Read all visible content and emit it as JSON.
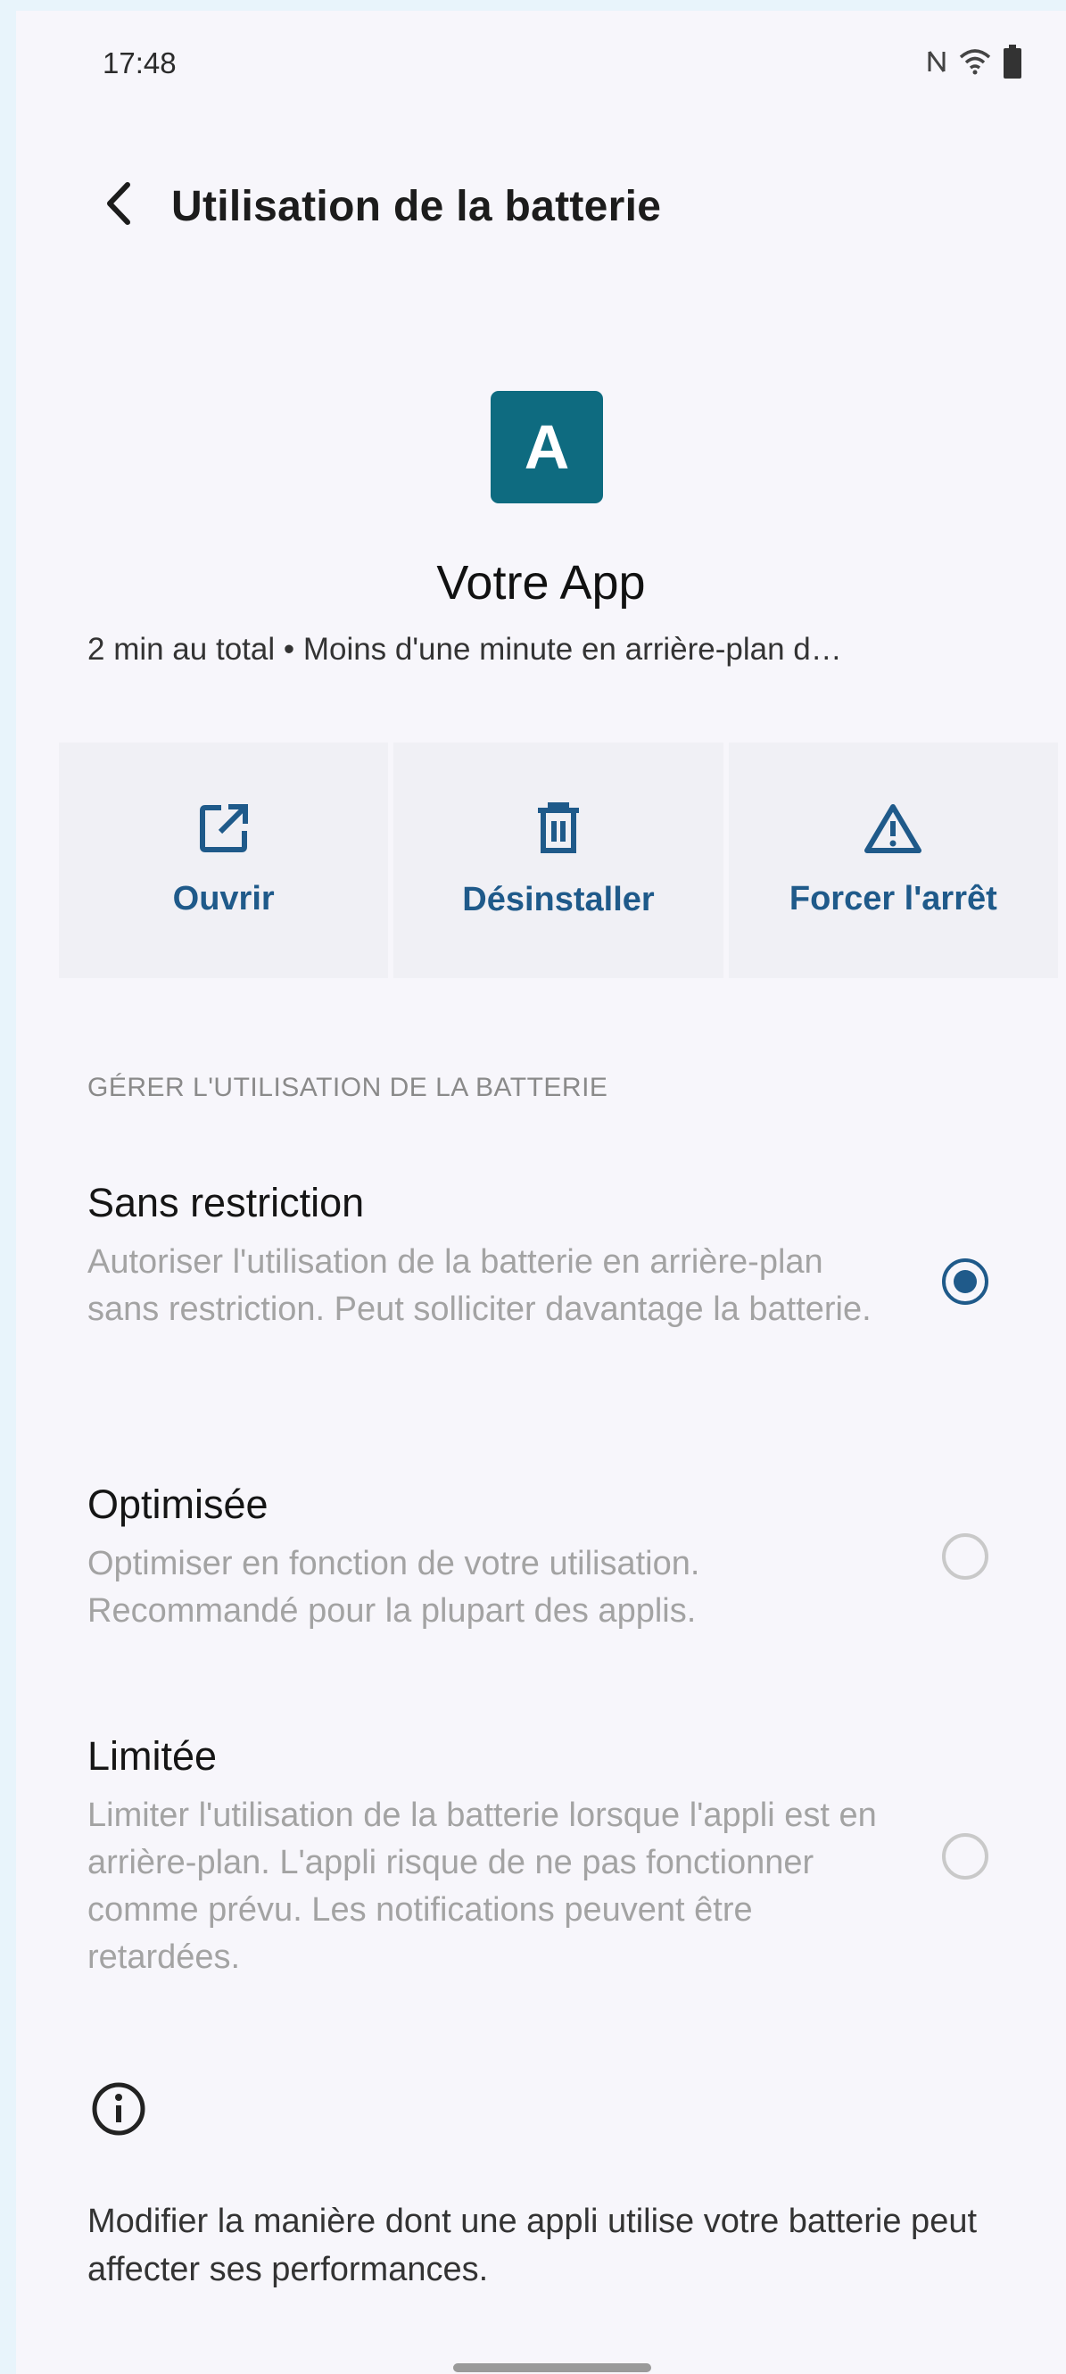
{
  "status_bar": {
    "time": "17:48",
    "icons": [
      "nfc-icon",
      "wifi-icon",
      "battery-icon"
    ]
  },
  "header": {
    "title": "Utilisation de la batterie",
    "back_icon": "chevron-left-icon"
  },
  "app": {
    "icon_letter": "A",
    "icon_color": "#0e6b80",
    "name": "Votre App",
    "summary": "2 min au total • Moins d'une minute en arrière-plan d…"
  },
  "actions": [
    {
      "label": "Ouvrir",
      "icon": "open-external-icon"
    },
    {
      "label": "Désinstaller",
      "icon": "trash-icon"
    },
    {
      "label": "Forcer l'arrêt",
      "icon": "warning-icon"
    }
  ],
  "section_header": "GÉRER L'UTILISATION DE LA BATTERIE",
  "options": [
    {
      "title": "Sans restriction",
      "description": "Autoriser l'utilisation de la batterie en arrière-plan sans restriction. Peut solliciter davantage la batterie.",
      "selected": true
    },
    {
      "title": "Optimisée",
      "description": "Optimiser en fonction de votre utilisation. Recommandé pour la plupart des applis.",
      "selected": false
    },
    {
      "title": "Limitée",
      "description": "Limiter l'utilisation de la batterie lorsque l'appli est en arrière-plan. L'appli risque de ne pas fonctionner comme prévu. Les notifications peuvent être retardées.",
      "selected": false
    }
  ],
  "footer": {
    "info_icon": "info-icon",
    "text": "Modifier la manière dont une appli utilise votre batterie peut affecter ses performances."
  },
  "colors": {
    "accent": "#1f5a8a",
    "background": "#f7f6fb"
  }
}
